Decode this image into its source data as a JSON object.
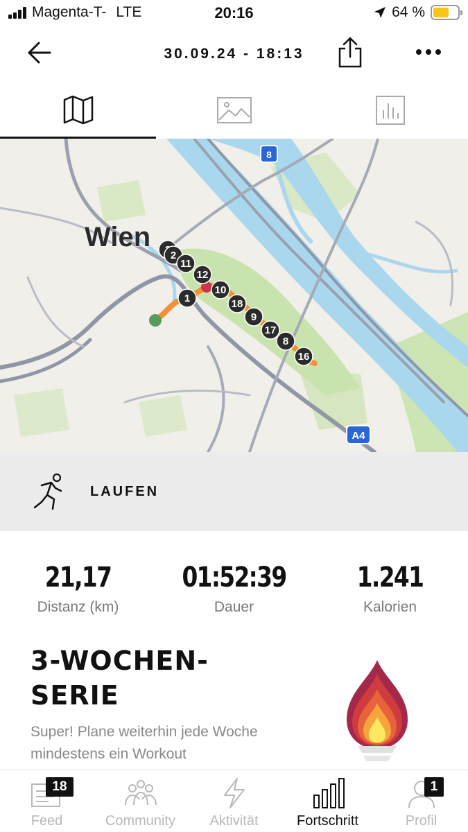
{
  "status_bar": {
    "carrier": "Magenta-T-",
    "network": "LTE",
    "time": "20:16",
    "battery_percent": "64 %",
    "battery_level": 0.64,
    "icons": [
      "signal-icon",
      "location-arrow-icon",
      "battery-icon"
    ]
  },
  "header": {
    "title": "30.09.24 - 18:13",
    "icons": [
      "back-arrow-icon",
      "share-icon",
      "more-icon"
    ]
  },
  "tabs": [
    {
      "icon": "map-icon",
      "active": true
    },
    {
      "icon": "image-icon",
      "active": false
    },
    {
      "icon": "bar-chart-icon",
      "active": false
    }
  ],
  "map": {
    "city_label": "Wien",
    "road_shields": [
      "8",
      "A4"
    ],
    "route_markers": [
      "3",
      "2",
      "11",
      "12",
      "1",
      "10",
      "18",
      "9",
      "17",
      "8",
      "16"
    ],
    "colors": {
      "route": "#f0913a",
      "start": "#5a9a5e",
      "end": "#c8364a",
      "marker": "#2b2b2b",
      "water": "#a9d7ee",
      "park": "#c9e3ae"
    }
  },
  "activity": {
    "label": "LAUFEN",
    "icon": "runner-icon"
  },
  "stats": [
    {
      "value": "21,17",
      "label": "Distanz (km)"
    },
    {
      "value": "01:52:39",
      "label": "Dauer"
    },
    {
      "value": "1.241",
      "label": "Kalorien"
    }
  ],
  "streak": {
    "title_line1": "3-WOCHEN-",
    "title_line2": "SERIE",
    "description": "Super! Plane weiterhin jede Woche mindestens ein Workout",
    "icon": "flame-icon"
  },
  "bottom_nav": [
    {
      "label": "Feed",
      "icon": "feed-icon",
      "badge": "18",
      "active": false
    },
    {
      "label": "Community",
      "icon": "community-icon",
      "badge": "",
      "active": false
    },
    {
      "label": "Aktivität",
      "icon": "lightning-icon",
      "badge": "",
      "active": false
    },
    {
      "label": "Fortschritt",
      "icon": "progress-bars-icon",
      "badge": "",
      "active": true
    },
    {
      "label": "Profil",
      "icon": "profile-icon",
      "badge": "1",
      "active": false
    }
  ]
}
